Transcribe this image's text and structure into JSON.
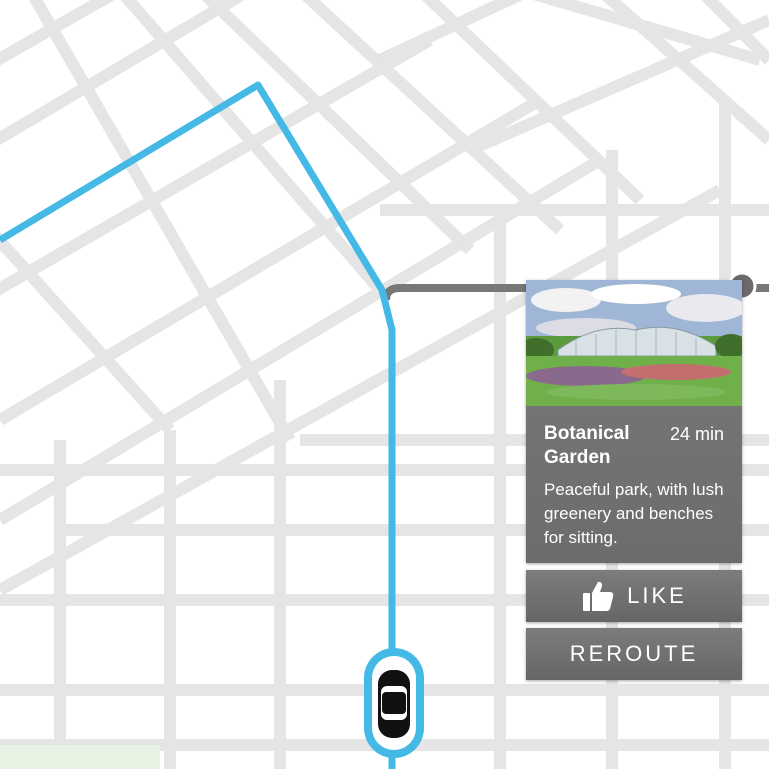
{
  "poi": {
    "name": "Botanical Garden",
    "eta": "24 min",
    "description": "Peaceful park, with lush greenery and benches for sitting."
  },
  "actions": {
    "like_label": "LIKE",
    "reroute_label": "REROUTE"
  },
  "icons": {
    "like": "thumbs-up-icon",
    "vehicle": "car-icon",
    "destination": "destination-pin-icon"
  },
  "colors": {
    "route": "#45b9e6",
    "detour": "#777777",
    "roads": "#e6e6e6",
    "card": "#737373"
  }
}
